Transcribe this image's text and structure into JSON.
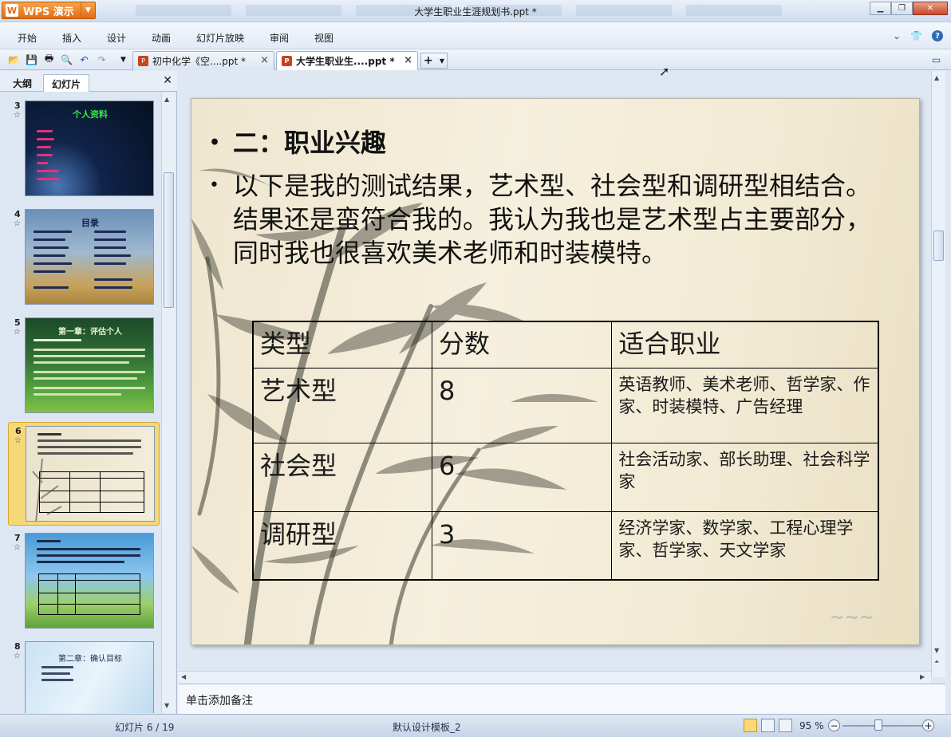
{
  "app": {
    "name": "WPS 演示",
    "logo_letter": "W",
    "window_title": "大学生职业生涯规划书.ppt *"
  },
  "menu": {
    "items": [
      "开始",
      "插入",
      "设计",
      "动画",
      "幻灯片放映",
      "审阅",
      "视图"
    ]
  },
  "doc_tabs": [
    {
      "label": "初中化学《空....ppt *",
      "active": false
    },
    {
      "label": "大学生职业生....ppt *",
      "active": true
    }
  ],
  "left_panel": {
    "tabs": [
      "大纲",
      "幻灯片"
    ],
    "active_tab": "幻灯片",
    "thumbnails": [
      {
        "number": "3",
        "title": "个人资料"
      },
      {
        "number": "4",
        "title": "目录"
      },
      {
        "number": "5",
        "title": "第一章：评估个人"
      },
      {
        "number": "6",
        "title": ""
      },
      {
        "number": "7",
        "title": ""
      },
      {
        "number": "8",
        "title": "第二章：确认目标"
      }
    ]
  },
  "slide": {
    "bullets": [
      "二：职业兴趣",
      "以下是我的测试结果，艺术型、社会型和调研型相结合。结果还是蛮符合我的。我认为我也是艺术型占主要部分，同时我也很喜欢美术老师和时装模特。"
    ],
    "table": {
      "headers": [
        "类型",
        "分数",
        "适合职业"
      ],
      "rows": [
        {
          "type": "艺术型",
          "score": "8",
          "jobs": "英语教师、美术老师、哲学家、作家、时装模特、广告经理"
        },
        {
          "type": "社会型",
          "score": "6",
          "jobs": "社会活动家、部长助理、社会科学家"
        },
        {
          "type": "调研型",
          "score": "3",
          "jobs": "经济学家、数学家、工程心理学家、哲学家、天文学家"
        }
      ]
    }
  },
  "notes_placeholder": "单击添加备注",
  "status": {
    "slide_indicator": "幻灯片 6 / 19",
    "template": "默认设计模板_2",
    "zoom": "95 %"
  },
  "colors": {
    "wps_orange": "#e06d12",
    "selected_thumb": "#f5d978",
    "close_red": "#c9472a"
  }
}
